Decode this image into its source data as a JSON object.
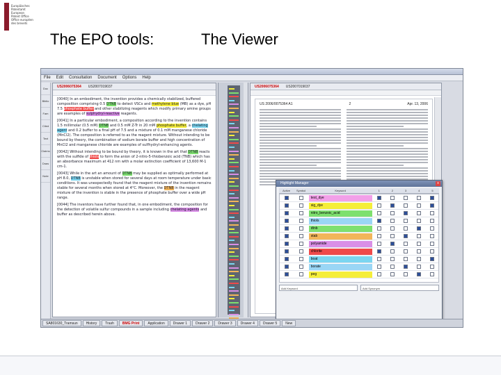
{
  "slide": {
    "logo_text": "Europäisches\nPatentamt\nEuropean\nPatent Office\nOffice européen\ndes brevets",
    "title_left": "The EPO tools:",
    "title_right": "The Viewer"
  },
  "app": {
    "menu": [
      "File",
      "Edit",
      "Consultation",
      "Document",
      "Options",
      "Help"
    ],
    "leftnav": [
      "Doc",
      "Biblio",
      "Fam",
      "Cited",
      "Text",
      "Claims",
      "Draw",
      "Note"
    ],
    "doc_tabs": [
      "US2006075364",
      "US2007019037"
    ],
    "doc_tab_active": 0,
    "doc_paragraphs": [
      {
        "segs": [
          {
            "t": "[0040] In an embodiment, the invention provides a chemically stabilized, buffered composition comprising 0.5 ",
            "h": ""
          },
          {
            "t": "DTNB",
            "h": "g"
          },
          {
            "t": " to detect VSCs and ",
            "h": ""
          },
          {
            "t": "methylene blue",
            "h": "y"
          },
          {
            "t": " (MB) as a dye, pH 7.5 ",
            "h": ""
          },
          {
            "t": "phosphate buffer",
            "h": "r"
          },
          {
            "t": " and other stabilizing reagents which modify primary amine groups are examples of ",
            "h": ""
          },
          {
            "t": "sulphydryl-reactive",
            "h": "p"
          },
          {
            "t": " reagents.",
            "h": ""
          }
        ]
      },
      {
        "segs": [
          {
            "t": "[0041] In a particular embodiment, a composition according to the invention contains 1.5 millimolar (0.5 mM) ",
            "h": ""
          },
          {
            "t": "DTNB",
            "h": "g"
          },
          {
            "t": " and 0.5 mM Z-Tr in 20 mM ",
            "h": ""
          },
          {
            "t": "phosphate buffer",
            "h": "y"
          },
          {
            "t": ", a ",
            "h": ""
          },
          {
            "t": "chelating agent",
            "h": "c"
          },
          {
            "t": " and 0.2 buffer to a final pH of 7.5 and a mixture of 0.1 mM manganese chloride (MnCl2). The composition is referred to as the reagent mixture. Without intending to be bound by theory, the combination of sodium borate buffer and high concentration of MnCl2 and manganese chloride are examples of sulfhydryl-enhancing agents.",
            "h": ""
          }
        ]
      },
      {
        "segs": [
          {
            "t": "[0042] Without intending to be bound by theory, it is known in the art that ",
            "h": ""
          },
          {
            "t": "DTNB",
            "h": "g"
          },
          {
            "t": " reacts with the sulfide of ",
            "h": ""
          },
          {
            "t": "thiols",
            "h": "r"
          },
          {
            "t": " to form the anion of 2-nitro-5-thiobenzoic acid (TNB) which has an absorbance maximum at 412 nm with a molar extinction coefficient of 13,600 M-1 cm-1.",
            "h": ""
          }
        ]
      },
      {
        "segs": [
          {
            "t": "[0043] While in the art an amount of ",
            "h": ""
          },
          {
            "t": "DTNB",
            "h": "g"
          },
          {
            "t": " may be supplied as optimally performed at pH 8.0, ",
            "h": ""
          },
          {
            "t": "DTNB",
            "h": "c"
          },
          {
            "t": " is unstable when stored for several days at room temperature under basic conditions. It was unexpectedly found that the reagent mixture of the invention remains stable for several months when stored at 4°C. Moreover, the ",
            "h": ""
          },
          {
            "t": "DTNB",
            "h": "o"
          },
          {
            "t": " in the reagent mixture of the invention is stable in the presence of phosphate buffer over a wide pH range.",
            "h": ""
          }
        ]
      },
      {
        "segs": [
          {
            "t": "[0044] The inventors have further found that, in one embodiment, the composition for the detection of volatile sulfur compounds in a sample including ",
            "h": ""
          },
          {
            "t": "chelating agents",
            "h": "p"
          },
          {
            "t": " and buffer as described herein above.",
            "h": ""
          }
        ]
      }
    ],
    "viewer_tabs": [
      "US2006075364",
      "US2007019037"
    ],
    "viewer_tab_active": 0,
    "viewer_page_left": "US 2006/0075364 A1",
    "viewer_page_center": "2",
    "viewer_page_right": "Apr. 13, 2006",
    "dialog": {
      "title": "Highlight Manager",
      "close": "x",
      "headers": [
        "Active",
        "Symbol",
        "Keyword",
        "1",
        "2",
        "3",
        "4",
        "5"
      ],
      "rows": [
        {
          "kw": "test_dye",
          "color": "#f2a0e8",
          "checks": [
            1,
            0,
            0,
            0,
            1
          ]
        },
        {
          "kw": "sig_dye",
          "color": "#f5ee3a",
          "checks": [
            0,
            1,
            0,
            0,
            1
          ]
        },
        {
          "kw": "nitro_benzoic_acid",
          "color": "#7ee06f",
          "checks": [
            0,
            0,
            1,
            0,
            0
          ]
        },
        {
          "kw": "thiols",
          "color": "#9ad6f5",
          "checks": [
            1,
            0,
            0,
            0,
            0
          ]
        },
        {
          "kw": "dtnb",
          "color": "#7ee06f",
          "checks": [
            0,
            0,
            0,
            1,
            0
          ]
        },
        {
          "kw": "stab",
          "color": "#f2b55a",
          "checks": [
            0,
            0,
            1,
            0,
            0
          ]
        },
        {
          "kw": "polyamide",
          "color": "#d98fe6",
          "checks": [
            0,
            1,
            0,
            0,
            0
          ]
        },
        {
          "kw": "chlorite",
          "color": "#f04a4a",
          "checks": [
            1,
            0,
            0,
            0,
            0
          ]
        },
        {
          "kw": "boat",
          "color": "#7bd6f0",
          "checks": [
            0,
            0,
            0,
            0,
            1
          ]
        },
        {
          "kw": "borate",
          "color": "#9ad6f5",
          "checks": [
            0,
            0,
            1,
            0,
            0
          ]
        },
        {
          "kw": "peg",
          "color": "#f5ee3a",
          "checks": [
            0,
            0,
            0,
            1,
            0
          ]
        }
      ],
      "add_keyword": "Add Keyword",
      "add_synonym": "Add Synonym",
      "footer_text": "Tip for advanced search: truncation \"colour\" ...",
      "btn_apply": "Apply",
      "btn_apply_close": "Apply & Close",
      "btn_cancel": "Cancel"
    },
    "taskbar": [
      "SA801630_Tramsun",
      "History",
      "Trash",
      "BMG Print",
      "Application",
      "Drawer 1",
      "Drawer 2",
      "Drawer 3",
      "Drawer 4",
      "Drawer 5",
      "New"
    ],
    "taskbar_active": 3
  },
  "colors": {
    "accent": "#cc0000",
    "brand": "#8a1b2b"
  }
}
